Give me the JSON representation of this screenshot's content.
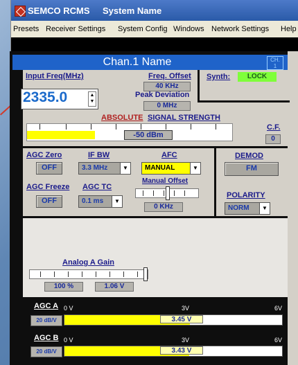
{
  "window": {
    "app_title": "SEMCO RCMS",
    "system_name": "System Name",
    "menu": [
      "Presets",
      "Receiver Settings",
      "System Config",
      "Windows",
      "Network Settings",
      "Help"
    ]
  },
  "channel": {
    "name": "Chan.1 Name",
    "ch_label": "CH.",
    "ch_number": "1"
  },
  "input_freq": {
    "label": "Input Freq(MHz)",
    "value": "2335.0"
  },
  "freq_offset": {
    "label": "Freq. Offset",
    "value": "40 KHz"
  },
  "peak_deviation": {
    "label": "Peak Deviation",
    "value": "0 MHz"
  },
  "synth": {
    "label": "Synth:",
    "status": "LOCK"
  },
  "signal_strength": {
    "label_abs": "ABSOLUTE",
    "label_rest": "SIGNAL STRENGTH",
    "value": "-50 dBm",
    "level_fraction": 0.33
  },
  "cf": {
    "label": "C.F.",
    "value": "0"
  },
  "agc_zero": {
    "label": "AGC Zero",
    "value": "OFF"
  },
  "if_bw": {
    "label": "IF BW",
    "value": "3.3 MHz"
  },
  "afc": {
    "label": "AFC",
    "value": "MANUAL"
  },
  "demod": {
    "label": "DEMOD",
    "value": "FM"
  },
  "agc_freeze": {
    "label": "AGC Freeze",
    "value": "OFF"
  },
  "agc_tc": {
    "label": "AGC TC",
    "value": "0.1 ms"
  },
  "manual_offset": {
    "label": "Manual Offset",
    "value": "0 KHz",
    "level_fraction": 0.5
  },
  "polarity": {
    "label": "POLARITY",
    "value": "NORM"
  },
  "analog_gain": {
    "label": "Analog A Gain",
    "percent": "100 %",
    "voltage": "1.06 V",
    "level_fraction": 1.0
  },
  "agc_a": {
    "label": "AGC A",
    "scale": "20 dB/V",
    "value": "3.45 V",
    "level_fraction": 0.575,
    "ticks": [
      "0 V",
      "3V",
      "6V"
    ]
  },
  "agc_b": {
    "label": "AGC B",
    "scale": "20 dB/V",
    "value": "3.43 V",
    "level_fraction": 0.572,
    "ticks": [
      "0 V",
      "3V",
      "6V"
    ]
  }
}
